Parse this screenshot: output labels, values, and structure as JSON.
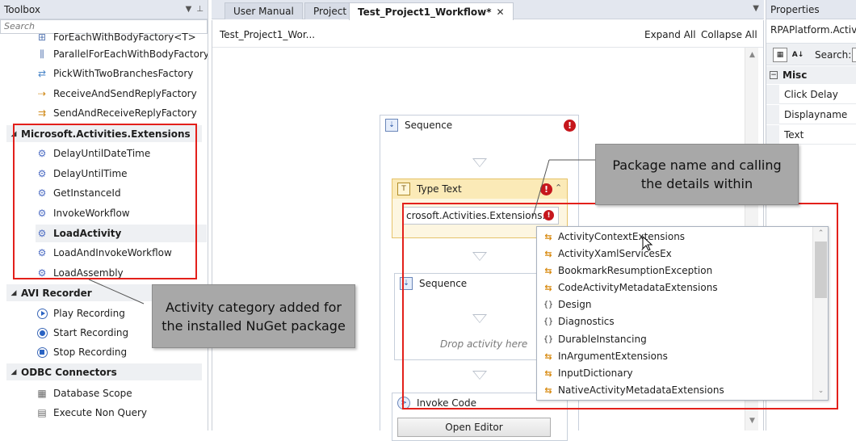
{
  "toolbox": {
    "title": "Toolbox",
    "search_placeholder": "Search",
    "items_top": [
      {
        "label": "ForEachWithBodyFactory<T>",
        "icon": "foreach-icon"
      },
      {
        "label": "ParallelForEachWithBodyFactory<",
        "icon": "parallel-icon"
      },
      {
        "label": "PickWithTwoBranchesFactory",
        "icon": "pick-icon"
      },
      {
        "label": "ReceiveAndSendReplyFactory",
        "icon": "receive-icon"
      },
      {
        "label": "SendAndReceiveReplyFactory",
        "icon": "send-icon"
      }
    ],
    "cat_extensions": "Microsoft.Activities.Extensions",
    "ext_items": [
      "DelayUntilDateTime",
      "DelayUntilTime",
      "GetInstanceId",
      "InvokeWorkflow",
      "LoadActivity",
      "LoadAndInvokeWorkflow",
      "LoadAssembly"
    ],
    "cat_avi": "AVI Recorder",
    "avi_items": [
      "Play Recording",
      "Start Recording",
      "Stop Recording"
    ],
    "cat_odbc": "ODBC Connectors",
    "odbc_items": [
      "Database Scope",
      "Execute Non Query"
    ]
  },
  "tabs": [
    "User Manual",
    "Project",
    "Test_Project1_Workflow*"
  ],
  "designer": {
    "breadcrumb": "Test_Project1_Wor...",
    "expand_all": "Expand All",
    "collapse_all": "Collapse All",
    "sequence_label": "Sequence",
    "type_text_label": "Type Text",
    "type_text_value": "crosoft.Activities.Extensions.",
    "inner_sequence_label": "Sequence",
    "drop_hint": "Drop activity here",
    "invoke_code_label": "Invoke Code",
    "open_editor": "Open Editor"
  },
  "popup_items": [
    {
      "label": "ActivityContextExtensions",
      "kind": "ext"
    },
    {
      "label": "ActivityXamlServicesEx",
      "kind": "ext"
    },
    {
      "label": "BookmarkResumptionException",
      "kind": "ext"
    },
    {
      "label": "CodeActivityMetadataExtensions",
      "kind": "ext"
    },
    {
      "label": "Design",
      "kind": "ns"
    },
    {
      "label": "Diagnostics",
      "kind": "ns"
    },
    {
      "label": "DurableInstancing",
      "kind": "ns"
    },
    {
      "label": "InArgumentExtensions",
      "kind": "ext"
    },
    {
      "label": "InputDictionary",
      "kind": "ext"
    },
    {
      "label": "NativeActivityMetadataExtensions",
      "kind": "ext"
    }
  ],
  "properties": {
    "title": "Properties",
    "type_name": "RPAPlatform.Activities",
    "search_label": "Search:",
    "misc": "Misc",
    "rows": [
      "Click Delay",
      "Displayname",
      "Text"
    ]
  },
  "callouts": {
    "package": "Package name and calling\nthe details within",
    "category": "Activity category added for\nthe installed NuGet package"
  },
  "colors": {
    "annotation_red": "#e3201b",
    "callout_gray": "#a8a8a8",
    "error_red": "#c6161c"
  }
}
